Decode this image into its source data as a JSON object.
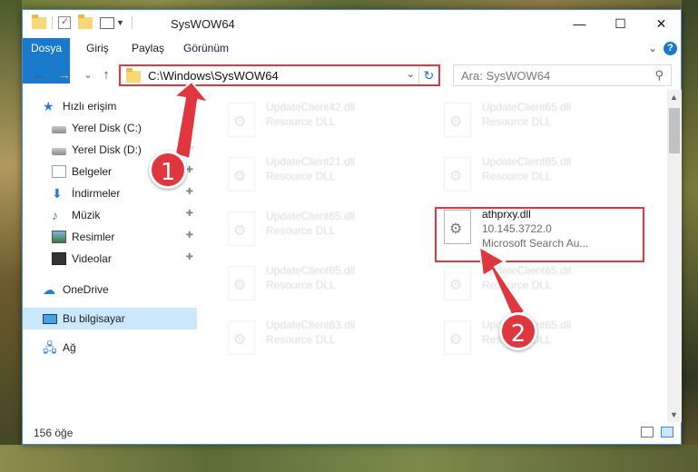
{
  "window": {
    "title": "SysWOW64",
    "minimize_glyph": "—",
    "maximize_glyph": "☐",
    "close_glyph": "✕"
  },
  "ribbon": {
    "tabs": [
      "Dosya",
      "Giriş",
      "Paylaş",
      "Görünüm"
    ],
    "expand_glyph": "⌄",
    "help_glyph": "?"
  },
  "navigation": {
    "back_glyph": "←",
    "forward_glyph": "→",
    "recent_glyph": "⌄",
    "up_glyph": "↑",
    "address": "C:\\Windows\\SysWOW64",
    "address_dropdown_glyph": "⌄",
    "refresh_glyph": "↻",
    "search_placeholder": "Ara: SysWOW64",
    "search_glyph": "⚲"
  },
  "sidebar": {
    "items": [
      {
        "label": "Hızlı erişim",
        "icon": "star-icon"
      },
      {
        "label": "Yerel Disk (C:)",
        "icon": "drive-icon",
        "pinned": true
      },
      {
        "label": "Yerel Disk (D:)",
        "icon": "drive-icon",
        "pinned": true
      },
      {
        "label": "Belgeler",
        "icon": "document-icon",
        "pinned": true
      },
      {
        "label": "İndirmeler",
        "icon": "download-icon",
        "pinned": true
      },
      {
        "label": "Müzik",
        "icon": "music-icon",
        "pinned": true
      },
      {
        "label": "Resimler",
        "icon": "pictures-icon",
        "pinned": true
      },
      {
        "label": "Videolar",
        "icon": "videos-icon",
        "pinned": true
      },
      {
        "label": "OneDrive",
        "icon": "cloud-icon"
      },
      {
        "label": "Bu bilgisayar",
        "icon": "computer-icon",
        "selected": true
      },
      {
        "label": "Ağ",
        "icon": "network-icon"
      }
    ],
    "pin_glyph": "📌"
  },
  "files": [
    {
      "name": "UpdateClient42.dll",
      "type": "Resource DLL"
    },
    {
      "name": "UpdateClient65.dll",
      "type": "Resource DLL"
    },
    {
      "name": "UpdateClient21.dll",
      "type": "Resource DLL"
    },
    {
      "name": "UpdateClient65.dll",
      "type": "Resource DLL"
    },
    {
      "name": "UpdateClient65.dll",
      "type": "Resource DLL"
    },
    {
      "name": "athprxy.dll",
      "version": "10.145.3722.0",
      "description": "Microsoft Search Au..."
    },
    {
      "name": "UpdateClient65.dll",
      "type": "Resource DLL"
    },
    {
      "name": "UpdateClient65.dll",
      "type": "Resource DLL"
    },
    {
      "name": "UpdateClient63.dll",
      "type": "Resource DLL"
    },
    {
      "name": "UpdateClient65.dll",
      "type": "Resource DLL"
    }
  ],
  "status": {
    "item_count": "156 öğe"
  },
  "annotations": {
    "step1": "1",
    "step2": "2",
    "color": "#e0363f"
  }
}
